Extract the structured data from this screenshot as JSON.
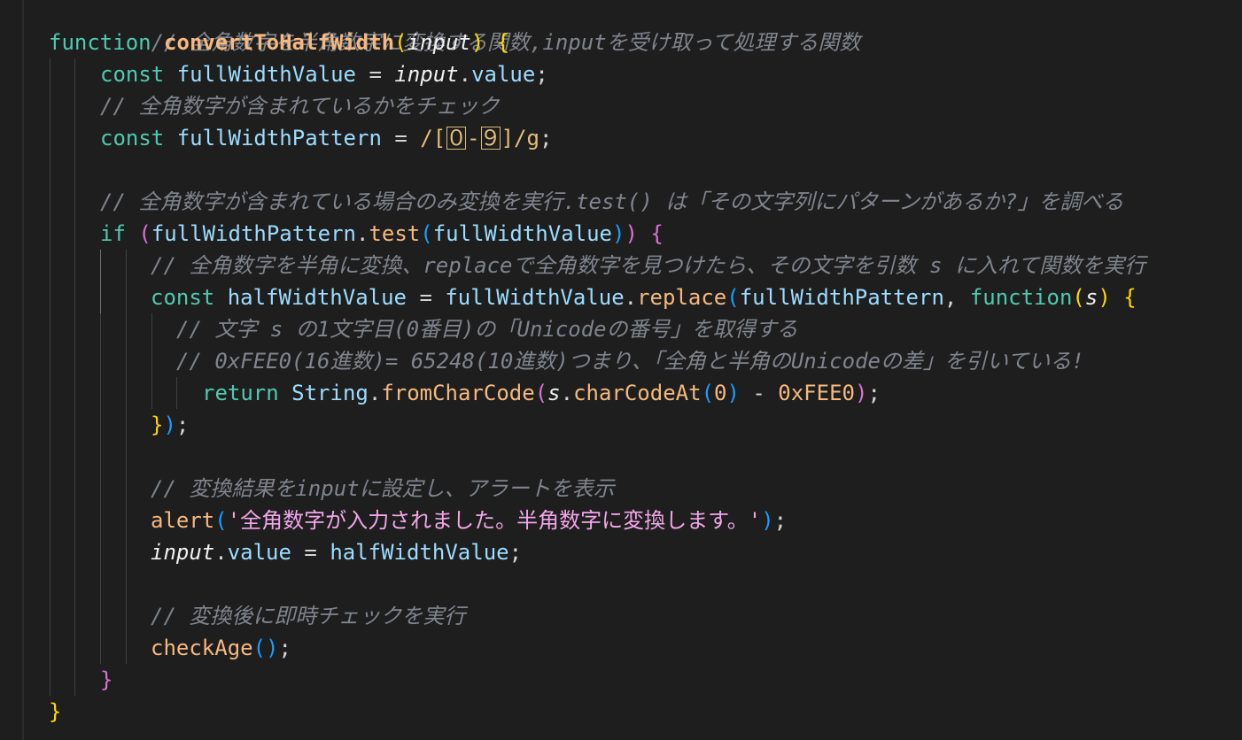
{
  "editor": {
    "colors": {
      "background": "#1e1e1e",
      "comment": "#7f848e",
      "keyword": "#4ec9b0",
      "function": "#f5b97f",
      "variable": "#9cdcfe",
      "string": "#f2a6e8",
      "bracket_gold": "#ffd700",
      "bracket_purple": "#da70d6",
      "bracket_blue": "#179fff"
    },
    "code": {
      "l1": {
        "comment": "// 全角数字を半角数字に変換する関数,inputを受け取って処理する関数"
      },
      "l2": {
        "kw": "function",
        "name": "convertToHalfWidth",
        "open": "(",
        "param": "input",
        "close": ")",
        "brace": "{"
      },
      "l3": {
        "kw": "const",
        "name": "fullWidthValue",
        "eq": " = ",
        "obj": "input",
        "dot": ".",
        "prop": "value",
        "end": ";"
      },
      "l4": {
        "comment": "// 全角数字が含まれているかをチェック"
      },
      "l5": {
        "kw": "const",
        "name": "fullWidthPattern",
        "eq": " = ",
        "rx_start": "/[",
        "rx_a": "０",
        "rx_dash": "-",
        "rx_b": "９",
        "rx_end": "]/g",
        "end": ";"
      },
      "l7": {
        "comment": "// 全角数字が含まれている場合のみ変換を実行.test() は「その文字列にパターンがあるか?」を調べる"
      },
      "l8": {
        "kw": "if",
        "open": "(",
        "obj": "fullWidthPattern",
        "dot": ".",
        "method": "test",
        "open2": "(",
        "arg": "fullWidthValue",
        "close2": ")",
        "close": ")",
        "brace": "{"
      },
      "l9": {
        "comment": "// 全角数字を半角に変換、replaceで全角数字を見つけたら、その文字を引数 s に入れて関数を実行"
      },
      "l10": {
        "kw": "const",
        "name": "halfWidthValue",
        "eq": " = ",
        "obj": "fullWidthValue",
        "dot": ".",
        "method": "replace",
        "open": "(",
        "arg": "fullWidthPattern",
        "comma": ", ",
        "kw2": "function",
        "open2": "(",
        "param": "s",
        "close2": ")",
        "brace": "{"
      },
      "l11": {
        "comment": "// 文字 s の1文字目(0番目)の「Unicodeの番号」を取得する"
      },
      "l12": {
        "comment": "// 0xFEE0(16進数)= 65248(10進数)つまり、「全角と半角のUnicodeの差」を引いている!"
      },
      "l13": {
        "kw": "return",
        "cls": "String",
        "dot": ".",
        "method": "fromCharCode",
        "open": "(",
        "obj": "s",
        "dot2": ".",
        "method2": "charCodeAt",
        "open2": "(",
        "num": "0",
        "close2": ")",
        "minus": " - ",
        "hex": "0xFEE0",
        "close": ")",
        "end": ";"
      },
      "l14": {
        "brace": "}",
        "paren": ")",
        "end": ";"
      },
      "l16": {
        "comment": "// 変換結果をinputに設定し、アラートを表示"
      },
      "l17": {
        "fn": "alert",
        "open": "(",
        "str": "'全角数字が入力されました。半角数字に変換します。'",
        "close": ")",
        "end": ";"
      },
      "l18": {
        "obj": "input",
        "dot": ".",
        "prop": "value",
        "eq": " = ",
        "val": "halfWidthValue",
        "end": ";"
      },
      "l20": {
        "comment": "// 変換後に即時チェックを実行"
      },
      "l21": {
        "fn": "checkAge",
        "open": "(",
        "close": ")",
        "end": ";"
      },
      "l22": {
        "brace": "}"
      },
      "l23": {
        "brace": "}"
      }
    }
  }
}
